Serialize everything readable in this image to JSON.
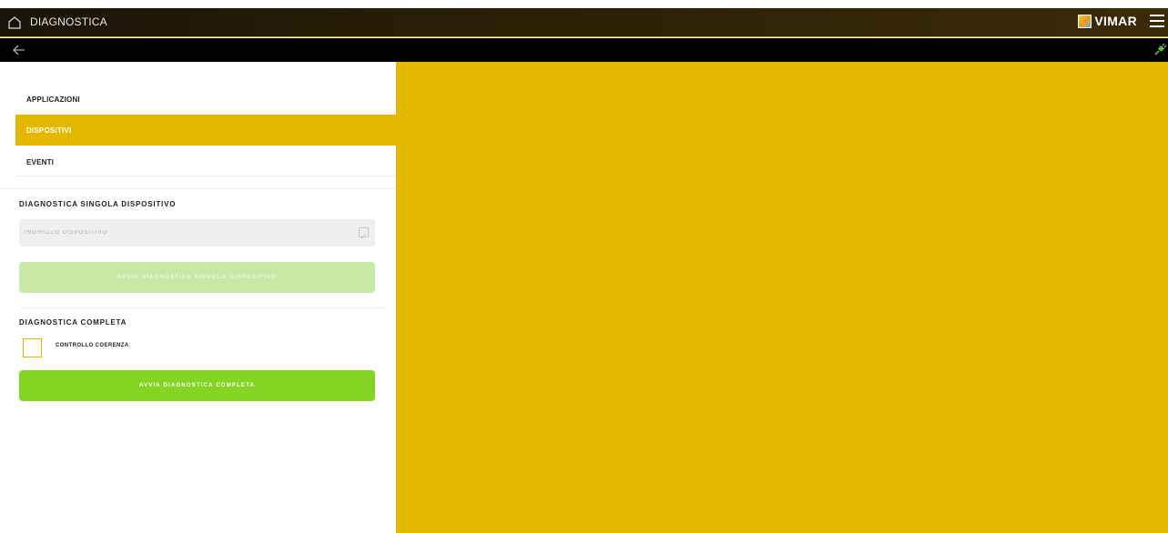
{
  "header": {
    "title": "DIAGNOSTICA",
    "brand": "VIMAR",
    "home_icon": "home-icon",
    "menu_icon": "hamburger-menu-icon"
  },
  "navbar": {
    "back_icon": "back-arrow-icon",
    "status_icon": "plug-icon"
  },
  "sidebar": {
    "items": [
      {
        "label": "APPLICAZIONI",
        "active": false
      },
      {
        "label": "DISPOSITIVI",
        "active": true
      },
      {
        "label": "EVENTI",
        "active": false
      }
    ]
  },
  "single_device": {
    "title": "DIAGNOSTICA SINGOLA DISPOSITIVO",
    "address_placeholder": "INDIRIZZO DISPOSITIVO",
    "address_value": "",
    "start_button": "AVVIA DIAGNOSTICA SINGOLO DISPOSITIVO"
  },
  "full": {
    "title": "DIAGNOSTICA COMPLETA",
    "checkbox_label": "CONTROLLO COERENZA",
    "checkbox_checked": false,
    "start_button": "AVVIA DIAGNOSTICA COMPLETA"
  },
  "colors": {
    "accent": "#e5b800",
    "primary_button": "#84d424",
    "disabled_button": "#c8e8a6",
    "header_bg": "#2a1f06"
  }
}
